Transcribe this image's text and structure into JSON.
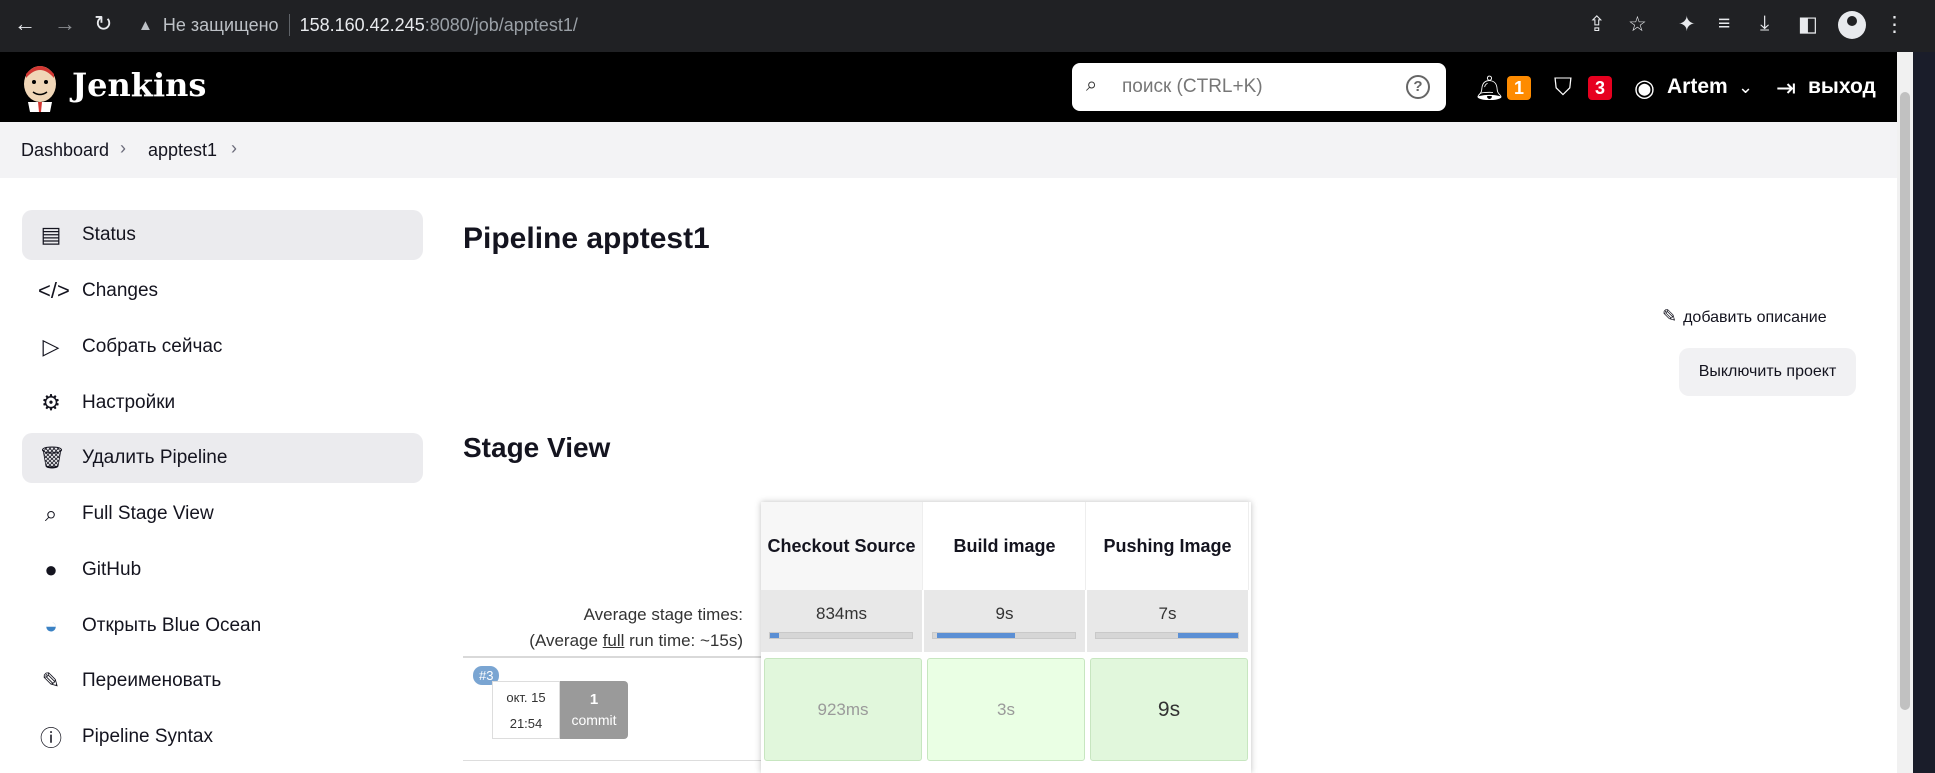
{
  "browser": {
    "security": "Не защищено",
    "url_host": "158.160.42.245",
    "url_path": ":8080/job/apptest1/"
  },
  "header": {
    "brand": "Jenkins",
    "search_placeholder": "поиск (CTRL+K)",
    "notifications_count": "1",
    "security_count": "3",
    "user": "Artem",
    "logout": "выход"
  },
  "breadcrumb": [
    "Dashboard",
    "apptest1"
  ],
  "sidebar": {
    "items": [
      {
        "label": "Status",
        "icon": "document-icon"
      },
      {
        "label": "Changes",
        "icon": "code-icon"
      },
      {
        "label": "Собрать сейчас",
        "icon": "play-icon"
      },
      {
        "label": "Настройки",
        "icon": "gear-icon"
      },
      {
        "label": "Удалить Pipeline",
        "icon": "trash-icon"
      },
      {
        "label": "Full Stage View",
        "icon": "search-icon"
      },
      {
        "label": "GitHub",
        "icon": "github-icon"
      },
      {
        "label": "Открыть Blue Ocean",
        "icon": "blue-ocean-icon"
      },
      {
        "label": "Переименовать",
        "icon": "pencil-icon"
      },
      {
        "label": "Pipeline Syntax",
        "icon": "help-icon"
      }
    ]
  },
  "main": {
    "title": "Pipeline apptest1",
    "add_description": "добавить описание",
    "disable_project": "Выключить проект",
    "stage_view_heading": "Stage View"
  },
  "stage_view": {
    "avg_label_line1": "Average stage times:",
    "avg_label_line2_pre": "(Average ",
    "avg_label_line2_link": "full",
    "avg_label_line2_post": " run time: ~15s)",
    "stages": [
      {
        "name": "Checkout Source",
        "avg": "834ms",
        "bar_fraction": 0.06
      },
      {
        "name": "Build image",
        "avg": "9s",
        "bar_fraction": 0.55
      },
      {
        "name": "Pushing Image",
        "avg": "7s",
        "bar_fraction": 0.42
      }
    ],
    "build": {
      "number": "#3",
      "date": "окт. 15",
      "time": "21:54",
      "commits": "1",
      "commit_label": "commit",
      "durations": [
        "923ms",
        "3s",
        "9s"
      ]
    }
  },
  "colors": {
    "success_cell": "#e1f7dc",
    "success_cell_light": "#eaffe4",
    "badge_orange": "#fe8b00",
    "badge_red": "#e6001f",
    "bar": "#5b8fd4"
  }
}
